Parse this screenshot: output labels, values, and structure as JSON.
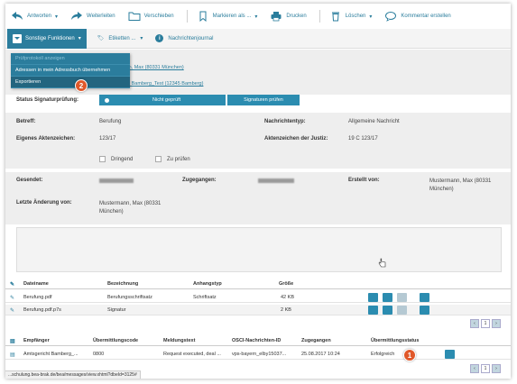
{
  "toolbar": {
    "items": [
      {
        "label": "Antworten",
        "icon": "reply-icon"
      },
      {
        "label": "Weiterleiten",
        "icon": "forward-icon"
      },
      {
        "label": "Verschieben",
        "icon": "folder-icon"
      },
      {
        "label": "Markieren als ...",
        "icon": "bookmark-icon"
      },
      {
        "label": "Drucken",
        "icon": "printer-icon"
      },
      {
        "label": "Löschen",
        "icon": "trash-icon"
      },
      {
        "label": "Kommentar erstellen",
        "icon": "comment-icon"
      }
    ]
  },
  "subbar": {
    "sonstige": "Sonstige Funktionen",
    "etiketten": "Etiketten ...",
    "nachrichtenjournal": "Nachrichtenjournal"
  },
  "dropdown": {
    "items": [
      "Prüfprotokoll anzeigen",
      "Adressen in mein Adressbuch übernehmen",
      "Exportieren"
    ]
  },
  "badges": {
    "one": "1",
    "two": "2"
  },
  "recipients": {
    "link1": "...n, Max (80331 München)",
    "link2": "...t Bamberg_Test (12345 Bamberg)"
  },
  "signature": {
    "label": "Status Signaturprüfung:",
    "status": "Nicht geprüft",
    "button": "Signaturen prüfen"
  },
  "details": {
    "betreff_label": "Betreff:",
    "betreff": "Berufung",
    "nachrichtentyp_label": "Nachrichtentyp:",
    "nachrichtentyp": "Allgemeine Nachricht",
    "eigenes_label": "Eigenes Aktenzeichen:",
    "eigenes": "123/17",
    "justiz_label": "Aktenzeichen der Justiz:",
    "justiz": "19 C 123/17",
    "dringend": "Dringend",
    "zu_pruefen": "Zu prüfen"
  },
  "meta": {
    "gesendet_label": "Gesendet:",
    "zugegangen_label": "Zugegangen:",
    "erstellt_label": "Erstellt von:",
    "erstellt": "Mustermann, Max (80331 München)",
    "letzte_label": "Letzte Änderung von:",
    "letzte": "Mustermann, Max (80331 München)"
  },
  "attachments": {
    "headers": [
      "Dateiname",
      "Bezeichnung",
      "Anhangstyp",
      "Größe"
    ],
    "rows": [
      {
        "file": "Berufung.pdf",
        "desc": "Berufungsschriftsatz",
        "type": "Schriftsatz",
        "size": "42 KB"
      },
      {
        "file": "Berufung.pdf.p7s",
        "desc": "Signatur",
        "type": "",
        "size": "2 KB"
      }
    ]
  },
  "pager": {
    "current": "1"
  },
  "transmission": {
    "headers": [
      "Empfänger",
      "Übermittlungscode",
      "Meldungstext",
      "OSCI-Nachrichten-ID",
      "Zugegangen",
      "Übermittlungsstatus"
    ],
    "rows": [
      {
        "recipient": "Amtsgericht Bamberg_...",
        "code": "0800",
        "text": "Request executed, deal ...",
        "osci": "vps-bayern_elby15037...",
        "zugegangen": "25.08.2017 10:24",
        "status": "Erfolgreich"
      }
    ]
  },
  "statusbar": "...schulung.bea-brak.de/bea/messages/view.xhtml?dbeId=3125#",
  "colors": {
    "accent": "#2b7d9d",
    "badge": "#e0582a"
  }
}
